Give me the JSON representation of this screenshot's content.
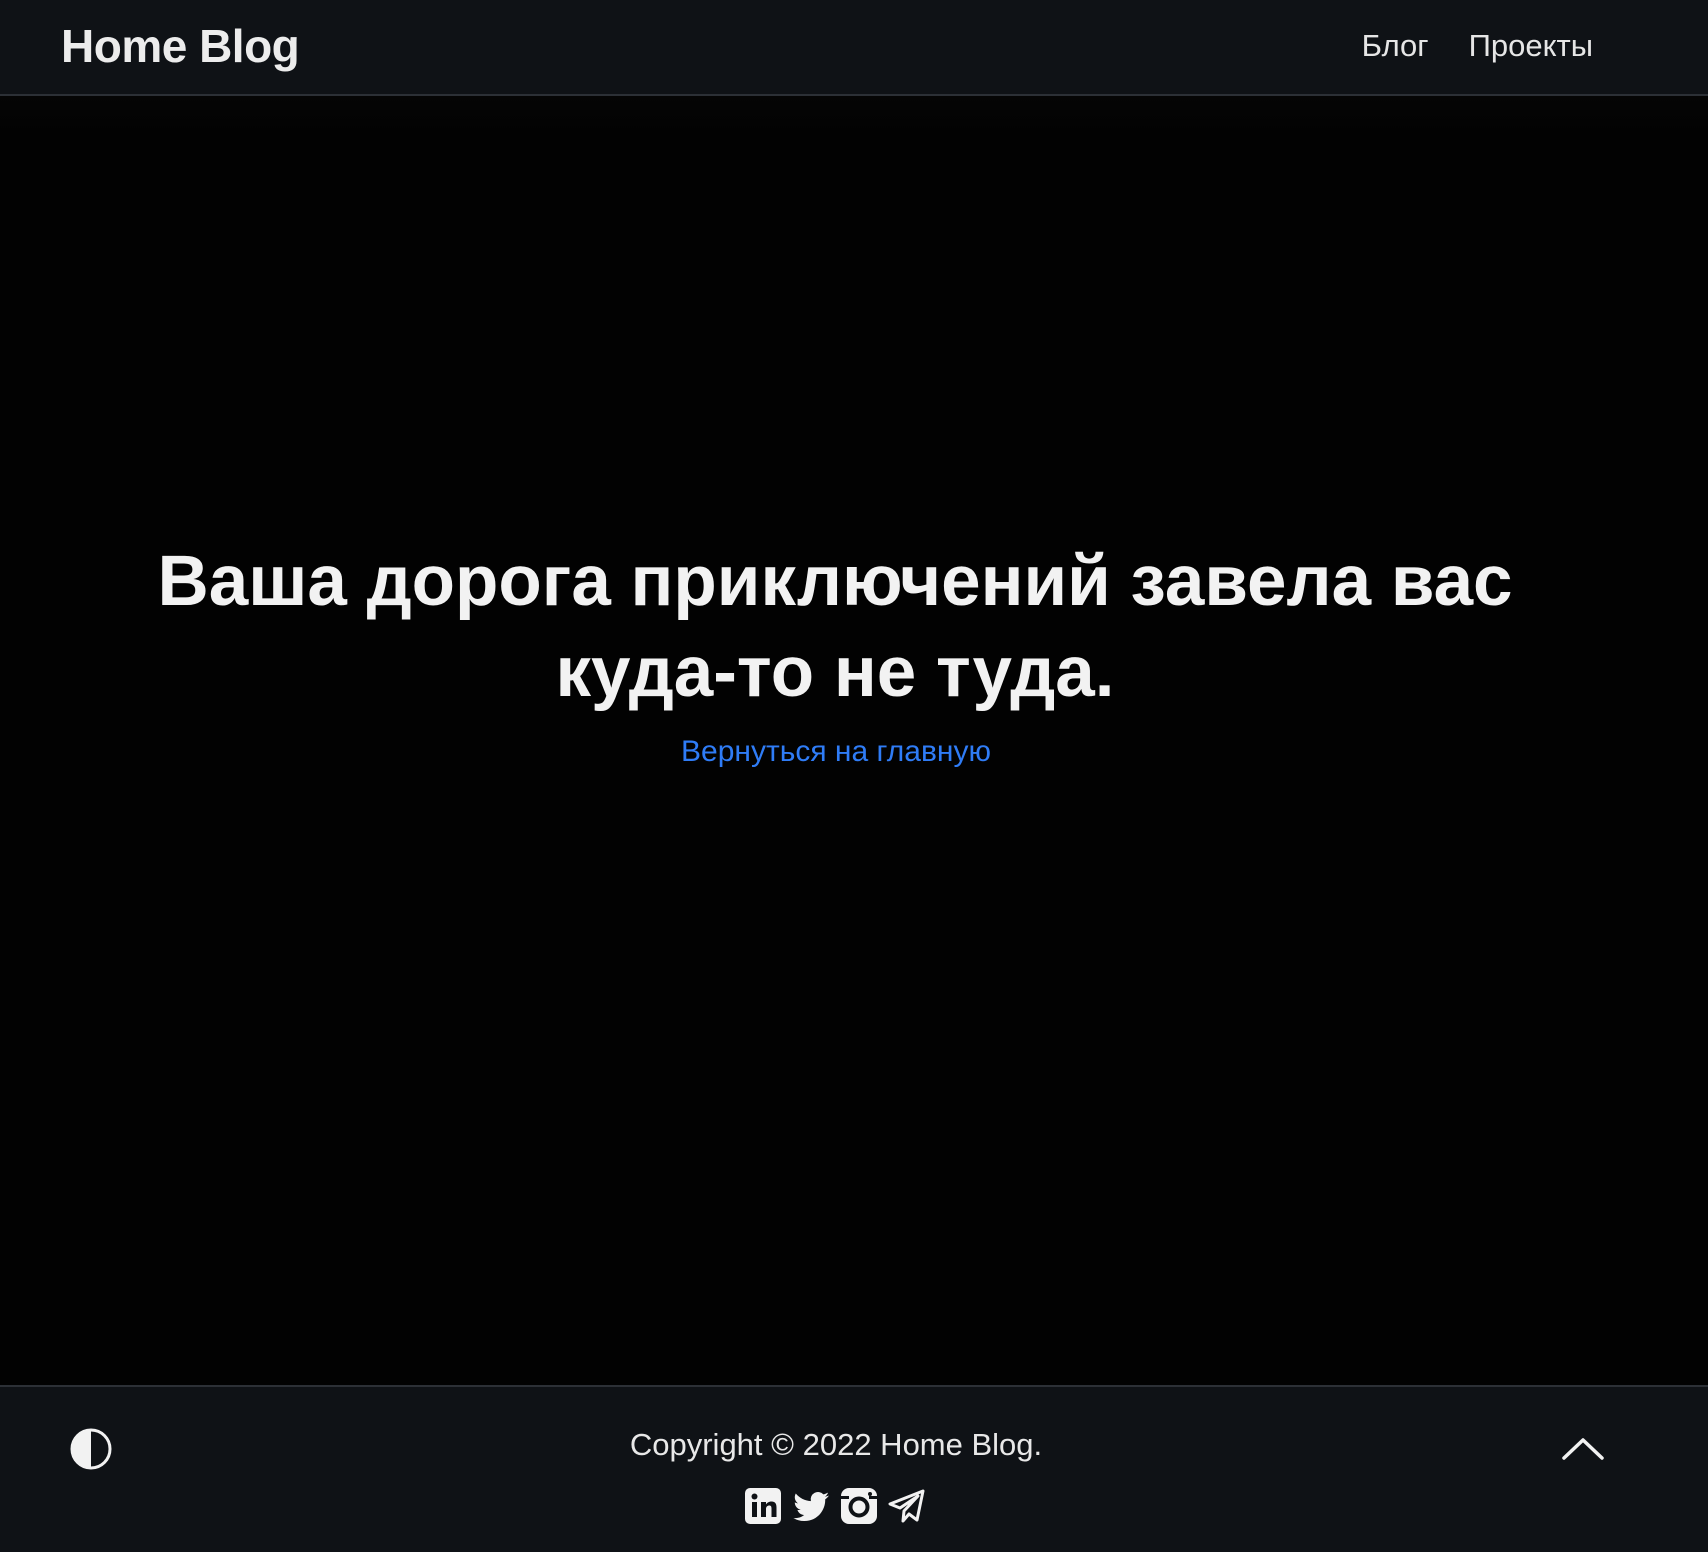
{
  "header": {
    "logo": "Home Blog",
    "nav": [
      {
        "label": "Блог"
      },
      {
        "label": "Проекты"
      }
    ]
  },
  "main": {
    "headline": "Ваша дорога приключений завела вас куда-то не туда.",
    "home_link": "Вернуться на главную"
  },
  "footer": {
    "copyright": "Copyright © 2022 Home Blog.",
    "theme_toggle_icon": "half-circle-contrast-icon",
    "scroll_top_icon": "chevron-up-icon",
    "social_icons": [
      "linkedin-icon",
      "twitter-icon",
      "instagram-icon",
      "telegram-icon"
    ]
  },
  "colors": {
    "background": "#000000",
    "header_bg": "#0f1216",
    "text": "#eeeeee",
    "link": "#2f7cf6"
  }
}
